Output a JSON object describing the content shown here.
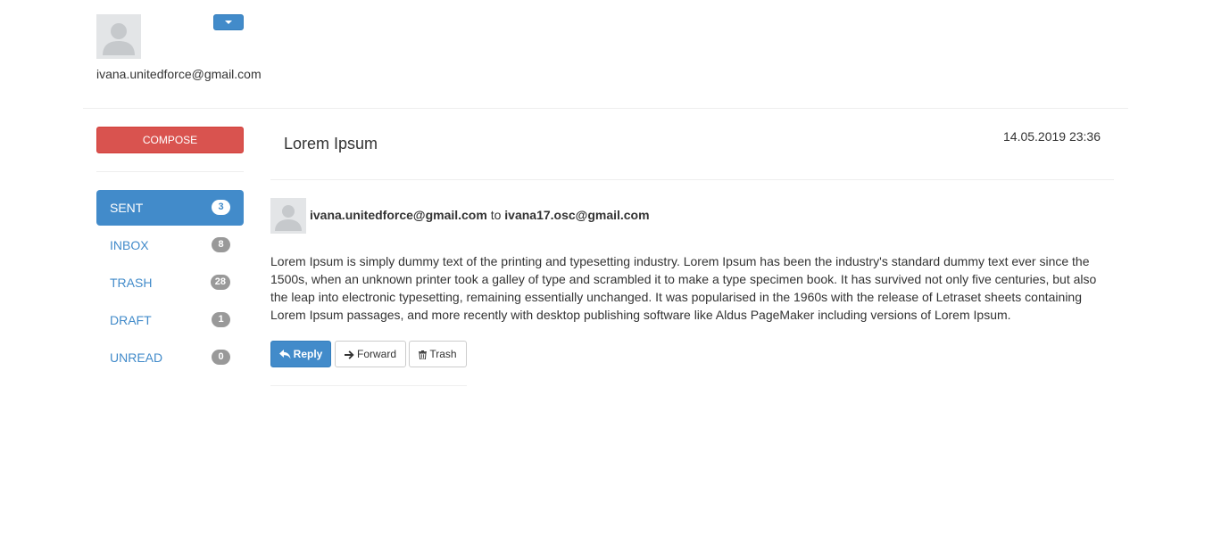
{
  "profile": {
    "email": "ivana.unitedforce@gmail.com",
    "avatar_icon": "user-placeholder-icon",
    "dropdown_icon": "caret-down-icon"
  },
  "sidebar": {
    "compose_label": "COMPOSE",
    "folders": [
      {
        "label": "SENT",
        "count": "3",
        "active": true
      },
      {
        "label": "INBOX",
        "count": "8",
        "active": false
      },
      {
        "label": "TRASH",
        "count": "28",
        "active": false
      },
      {
        "label": "DRAFT",
        "count": "1",
        "active": false
      },
      {
        "label": "UNREAD",
        "count": "0",
        "active": false
      }
    ]
  },
  "message": {
    "subject": "Lorem Ipsum",
    "date": "14.05.2019 23:36",
    "from": "ivana.unitedforce@gmail.com",
    "to_word": "to",
    "to": "ivana17.osc@gmail.com",
    "body": "Lorem Ipsum is simply dummy text of the printing and typesetting industry. Lorem Ipsum has been the industry's standard dummy text ever since the 1500s, when an unknown printer took a galley of type and scrambled it to make a type specimen book. It has survived not only five centuries, but also the leap into electronic typesetting, remaining essentially unchanged. It was popularised in the 1960s with the release of Letraset sheets containing Lorem Ipsum passages, and more recently with desktop publishing software like Aldus PageMaker including versions of Lorem Ipsum."
  },
  "actions": {
    "reply_label": "Reply",
    "forward_label": "Forward",
    "trash_label": "Trash",
    "reply_icon": "reply-icon",
    "forward_icon": "arrow-right-icon",
    "trash_icon": "trash-icon"
  },
  "colors": {
    "primary": "#428bca",
    "danger": "#d9534f",
    "badge": "#999999",
    "text": "#333333"
  }
}
